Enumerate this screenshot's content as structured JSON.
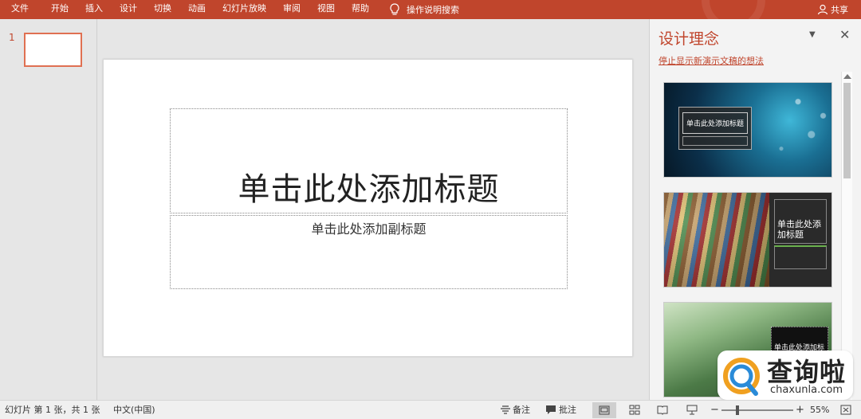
{
  "ribbon": {
    "tabs": [
      "文件",
      "开始",
      "插入",
      "设计",
      "切换",
      "动画",
      "幻灯片放映",
      "审阅",
      "视图",
      "帮助"
    ],
    "tell_me": "操作说明搜索",
    "share": "共享",
    "color": "#c0452c"
  },
  "thumbnails": {
    "slide_number": "1"
  },
  "slide": {
    "title_placeholder": "单击此处添加标题",
    "subtitle_placeholder": "单击此处添加副标题"
  },
  "design_pane": {
    "title": "设计理念",
    "stop_link": "停止显示新演示文稿的想法",
    "cards": [
      {
        "title": "单击此处添加标题"
      },
      {
        "title": "单击此处添加标题"
      },
      {
        "title": "单击此处添加标"
      }
    ]
  },
  "status": {
    "slide_info": "幻灯片 第 1 张，共 1 张",
    "language": "中文(中国)",
    "notes": "备注",
    "comments": "批注",
    "zoom_minus": "−",
    "zoom_plus": "+",
    "zoom": "55%"
  },
  "watermark": {
    "brand_cn": "查询啦",
    "brand_en": "chaxunla.com"
  }
}
